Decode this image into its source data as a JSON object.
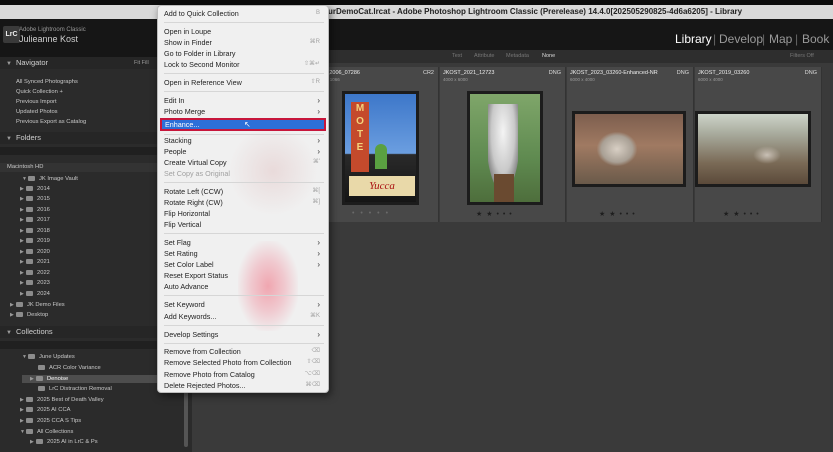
{
  "titlebar": {
    "title": "urDemoCat.lrcat - Adobe Photoshop Lightroom Classic (Prerelease) 14.4.0[202505290825-4d6a6205] - Library"
  },
  "header": {
    "logo": "LrC",
    "app_name": "Adobe Lightroom Classic",
    "user": "Julieanne Kost",
    "modules": [
      "Library",
      "Develop",
      "Map",
      "Book"
    ],
    "active_module": "Library"
  },
  "navigator": {
    "title": "Navigator",
    "zoom": "Fit  Fill"
  },
  "catalog": {
    "items": [
      "All Synced Photographs",
      "Quick Collection +",
      "Previous Import",
      "Updated Photos",
      "Previous Export as Catalog"
    ]
  },
  "folders": {
    "title": "Folders",
    "volume": "Macintosh HD",
    "root": "JK Image Vault",
    "years": [
      "2014",
      "2015",
      "2016",
      "2017",
      "2018",
      "2019",
      "2020",
      "2021",
      "2022",
      "2023",
      "2024"
    ],
    "others": [
      "JK Demo Files",
      "Desktop"
    ]
  },
  "collections": {
    "title": "Collections",
    "items": [
      "June Updates",
      "ACR Color Variance",
      "Denoise",
      "LrC Distraction Removal",
      "2025 Best of Death Valley",
      "2025 AI CCA",
      "2025 CCA S Tips",
      "All Collections",
      "2025 AI in LrC & Ps"
    ]
  },
  "filter": {
    "tabs": [
      "Text",
      "Attribute",
      "Metadata",
      "None"
    ],
    "active": "None",
    "preset": "Filters Off"
  },
  "grid": {
    "cells": [
      {
        "name": "jkost_2006_07286",
        "sub": "1600 x 1066",
        "type": "CR2",
        "stars": "• • • • •"
      },
      {
        "name": "JKOST_2021_12723",
        "sub": "4000 x 6000",
        "type": "DNG",
        "stars": "★ ★ • • •"
      },
      {
        "name": "JKOST_2023_03260-Enhanced-NR",
        "sub": "6000 x 4000",
        "type": "DNG",
        "stars": "★ ★ • • •"
      },
      {
        "name": "JKOST_2019_03260",
        "sub": "6000 x 4000",
        "type": "DNG",
        "stars": "★ ★ • • •"
      }
    ]
  },
  "context_menu": {
    "items": [
      {
        "label": "Add to Quick Collection",
        "shortcut": "B"
      },
      {
        "label": "Open in Loupe",
        "shortcut": ""
      },
      {
        "label": "Show in Finder",
        "shortcut": "⌘R"
      },
      {
        "label": "Go to Folder in Library",
        "shortcut": ""
      },
      {
        "label": "Lock to Second Monitor",
        "shortcut": "⇧⌘↵"
      },
      {
        "label": "Open in Reference View",
        "shortcut": "⇧R"
      },
      {
        "label": "Edit In",
        "shortcut": "›"
      },
      {
        "label": "Photo Merge",
        "shortcut": "›"
      },
      {
        "label": "Enhance...",
        "shortcut": ""
      },
      {
        "label": "Stacking",
        "shortcut": "›"
      },
      {
        "label": "People",
        "shortcut": "›"
      },
      {
        "label": "Create Virtual Copy",
        "shortcut": "⌘'"
      },
      {
        "label": "Set Copy as Original",
        "shortcut": ""
      },
      {
        "label": "Rotate Left (CCW)",
        "shortcut": "⌘["
      },
      {
        "label": "Rotate Right (CW)",
        "shortcut": "⌘]"
      },
      {
        "label": "Flip Horizontal",
        "shortcut": ""
      },
      {
        "label": "Flip Vertical",
        "shortcut": ""
      },
      {
        "label": "Set Flag",
        "shortcut": "›"
      },
      {
        "label": "Set Rating",
        "shortcut": "›"
      },
      {
        "label": "Set Color Label",
        "shortcut": "›"
      },
      {
        "label": "Reset Export Status",
        "shortcut": ""
      },
      {
        "label": "Auto Advance",
        "shortcut": ""
      },
      {
        "label": "Set Keyword",
        "shortcut": "›"
      },
      {
        "label": "Add Keywords...",
        "shortcut": "⌘K"
      },
      {
        "label": "Develop Settings",
        "shortcut": "›"
      },
      {
        "label": "Remove from Collection",
        "shortcut": "⌫"
      },
      {
        "label": "Remove Selected Photo from Collection",
        "shortcut": "⇧⌫"
      },
      {
        "label": "Remove Photo from Catalog",
        "shortcut": "⌥⌫"
      },
      {
        "label": "Delete Rejected Photos...",
        "shortcut": "⌘⌫"
      }
    ]
  },
  "colors": {
    "accent": "#2c6fd8",
    "highlight_border": "#c7163b",
    "panel": "#2b2b2b",
    "grid": "#3a3a3a"
  }
}
